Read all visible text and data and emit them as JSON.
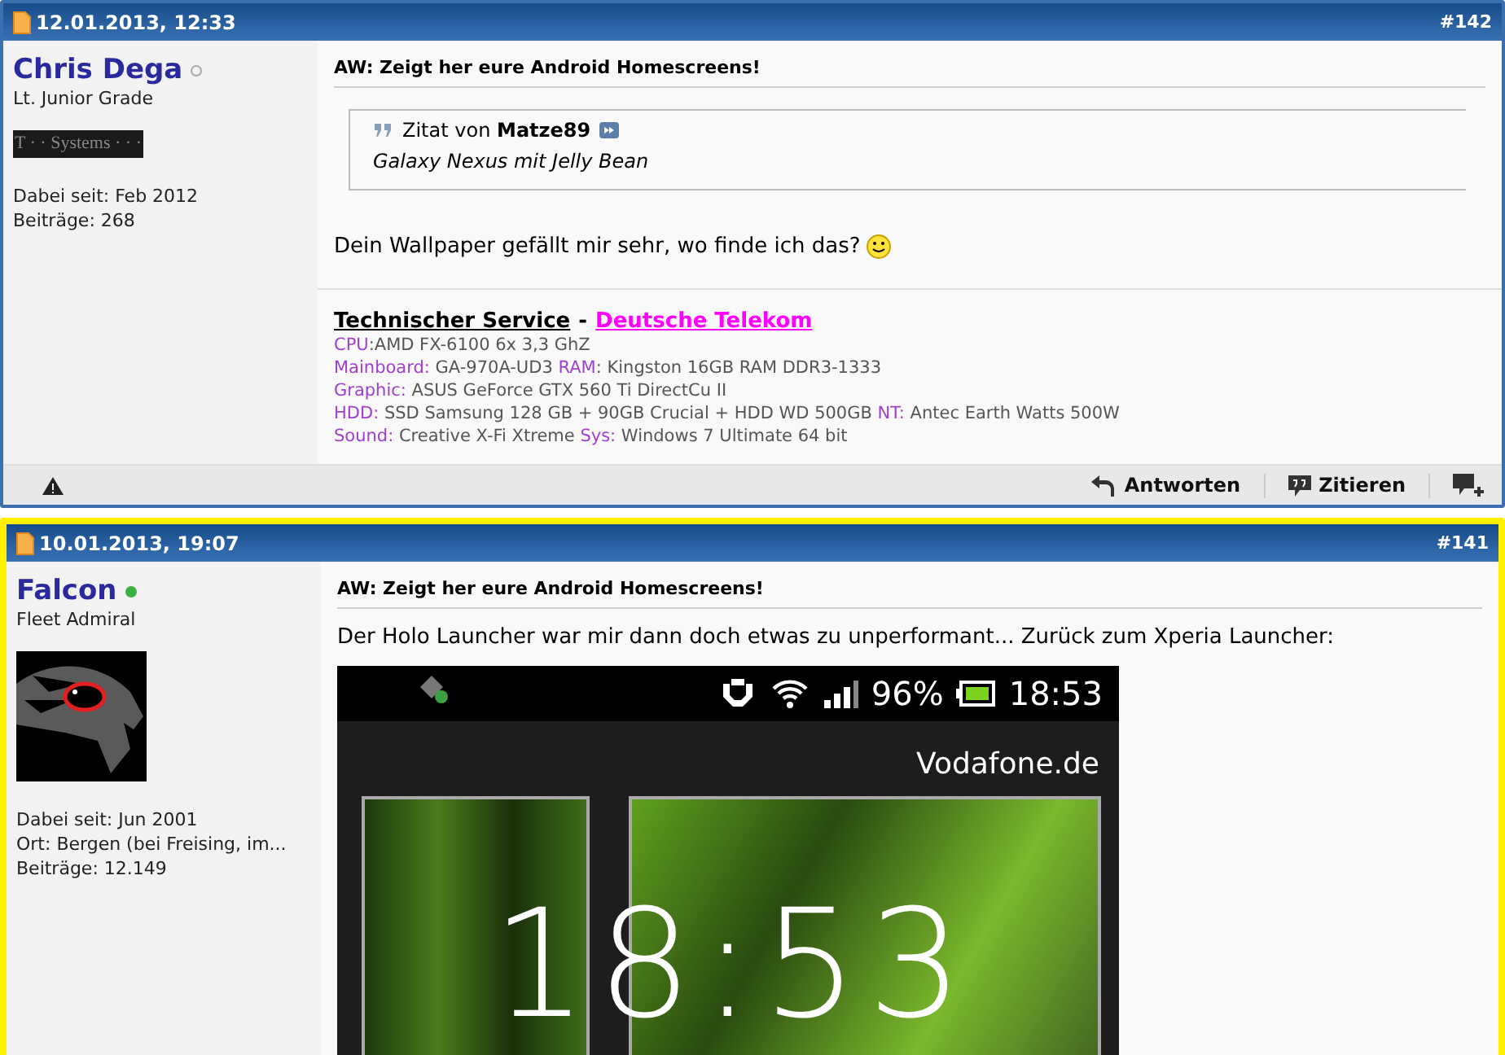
{
  "posts": [
    {
      "date": "12.01.2013, 12:33",
      "number": "#142",
      "highlighted": false,
      "user": {
        "name": "Chris Dega",
        "online": false,
        "rank": "Lt. Junior Grade",
        "badge": "T · · Systems · · ·",
        "stats": [
          "Dabei seit: Feb 2012",
          "Beiträge: 268"
        ]
      },
      "title": "AW: Zeigt her eure Android Homescreens!",
      "quote": {
        "prefix": "Zitat von",
        "author": "Matze89",
        "text": "Galaxy Nexus mit Jelly Bean"
      },
      "body": "Dein Wallpaper gefällt mir sehr, wo finde ich das?",
      "smiley": true,
      "signature": {
        "title": "Technischer Service",
        "separator": "-",
        "link": "Deutsche Telekom",
        "lines": [
          [
            {
              "kind": "label",
              "text": "CPU"
            },
            {
              "kind": "value",
              "text": ":AMD FX-6100 6x 3,3 GhZ"
            }
          ],
          [
            {
              "kind": "label",
              "text": "Mainboard:"
            },
            {
              "kind": "value",
              "text": " GA-970A-UD3 "
            },
            {
              "kind": "label",
              "text": "RAM"
            },
            {
              "kind": "value",
              "text": ": Kingston 16GB RAM DDR3-1333"
            }
          ],
          [
            {
              "kind": "label",
              "text": "Graphic:"
            },
            {
              "kind": "value",
              "text": " ASUS GeForce GTX 560 Ti DirectCu II"
            }
          ],
          [
            {
              "kind": "label",
              "text": "HDD:"
            },
            {
              "kind": "value",
              "text": " SSD Samsung 128 GB + 90GB Crucial + HDD WD 500GB "
            },
            {
              "kind": "label",
              "text": "NT:"
            },
            {
              "kind": "value",
              "text": " Antec Earth Watts 500W"
            }
          ],
          [
            {
              "kind": "label",
              "text": "Sound:"
            },
            {
              "kind": "value",
              "text": " Creative X-Fi Xtreme "
            },
            {
              "kind": "label",
              "text": "Sys:"
            },
            {
              "kind": "value",
              "text": " Windows 7 Ultimate 64 bit"
            }
          ]
        ]
      },
      "actions": [
        {
          "kind": "reply",
          "label": "Antworten"
        },
        {
          "kind": "quote",
          "label": "Zitieren"
        }
      ]
    },
    {
      "date": "10.01.2013, 19:07",
      "number": "#141",
      "highlighted": true,
      "user": {
        "name": "Falcon",
        "online": true,
        "rank": "Fleet Admiral",
        "avatar": true,
        "stats": [
          "Dabei seit: Jun 2001",
          "Ort: Bergen (bei Freising, im...",
          "Beiträge: 12.149"
        ]
      },
      "title": "AW: Zeigt her eure Android Homescreens!",
      "body": "Der Holo Launcher war mir dann doch etwas zu unperformant... Zurück zum Xperia Launcher:",
      "phone": {
        "battery": "96%",
        "time": "18:53",
        "carrier": "Vodafone.de",
        "clock": "18:53"
      }
    }
  ]
}
